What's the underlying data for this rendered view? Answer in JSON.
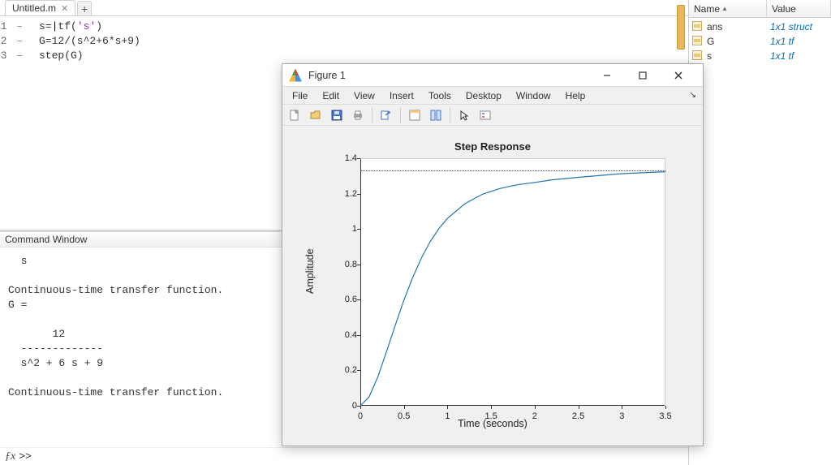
{
  "editor": {
    "filename": "Untitled.m",
    "lines": [
      {
        "n": "1",
        "text_a": "s=",
        "call": "tf",
        "paren_open": "(",
        "str": "'s'",
        "paren_close": ")"
      },
      {
        "n": "2",
        "text": "G=12/(s^2+6*s+9)"
      },
      {
        "n": "3",
        "text": "step(G)"
      }
    ]
  },
  "command_window": {
    "title": "Command Window",
    "lines": [
      "  s",
      " ",
      "Continuous-time transfer function.",
      "",
      "",
      "G =",
      " ",
      "       12",
      "  -------------",
      "  s^2 + 6 s + 9",
      " ",
      "Continuous-time transfer function."
    ],
    "prompt": ">> "
  },
  "workspace": {
    "columns": {
      "name": "Name",
      "value": "Value"
    },
    "rows": [
      {
        "name": "ans",
        "value": "1x1 struct"
      },
      {
        "name": "G",
        "value": "1x1 tf"
      },
      {
        "name": "s",
        "value": "1x1 tf"
      }
    ]
  },
  "figure": {
    "title": "Figure 1",
    "menu": [
      "File",
      "Edit",
      "View",
      "Insert",
      "Tools",
      "Desktop",
      "Window",
      "Help"
    ]
  },
  "chart_data": {
    "type": "line",
    "title": "Step Response",
    "xlabel": "Time (seconds)",
    "ylabel": "Amplitude",
    "xlim": [
      0,
      3.5
    ],
    "ylim": [
      0,
      1.4
    ],
    "xticks": [
      0,
      0.5,
      1,
      1.5,
      2,
      2.5,
      3,
      3.5
    ],
    "yticks": [
      0,
      0.2,
      0.4,
      0.6,
      0.8,
      1,
      1.2,
      1.4
    ],
    "steady_state": 1.333,
    "series": [
      {
        "name": "Step Response",
        "color": "#1f77b4",
        "x": [
          0,
          0.1,
          0.2,
          0.3,
          0.4,
          0.5,
          0.6,
          0.7,
          0.8,
          0.9,
          1.0,
          1.2,
          1.4,
          1.6,
          1.8,
          2.0,
          2.2,
          2.5,
          3.0,
          3.5
        ],
        "y": [
          0.0,
          0.049,
          0.162,
          0.305,
          0.454,
          0.597,
          0.725,
          0.835,
          0.927,
          1.001,
          1.06,
          1.143,
          1.196,
          1.229,
          1.25,
          1.263,
          1.278,
          1.292,
          1.313,
          1.324
        ]
      }
    ]
  }
}
